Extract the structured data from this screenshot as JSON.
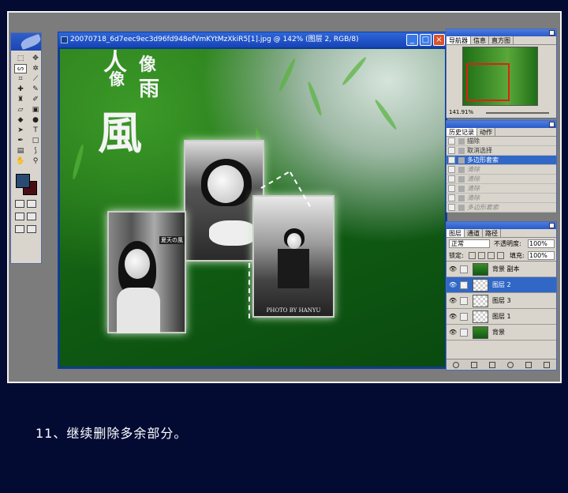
{
  "doc": {
    "title": "20070718_6d7eec9ec3d96fd948efVmKYtMzXkiR5[1].jpg @ 142% (图层 2, RGB/8)",
    "btn_min": "_",
    "btn_max": "□",
    "btn_close": "×"
  },
  "canvas": {
    "calligraphy": [
      "人",
      "像",
      "風",
      "雨",
      "像"
    ],
    "photo2_badge": "夏天の風",
    "photo3_credit": "PHOTO BY HANYU"
  },
  "navigator": {
    "tabs": [
      "导航器",
      "信息",
      "直方图"
    ],
    "zoom": "141.91%"
  },
  "history": {
    "tabs": [
      "历史记录",
      "动作"
    ],
    "rows": [
      {
        "label": "描除",
        "state": "normal"
      },
      {
        "label": "取消选择",
        "state": "normal"
      },
      {
        "label": "多边形套索",
        "state": "selected"
      },
      {
        "label": "清除",
        "state": "dim"
      },
      {
        "label": "清除",
        "state": "dim"
      },
      {
        "label": "清除",
        "state": "dim"
      },
      {
        "label": "清除",
        "state": "dim"
      },
      {
        "label": "多边形套索",
        "state": "dim"
      }
    ]
  },
  "layers": {
    "tabs": [
      "图层",
      "通道",
      "路径"
    ],
    "blend_mode": "正常",
    "opacity_label": "不透明度:",
    "opacity": "100%",
    "lock_label": "锁定:",
    "fill_label": "填充:",
    "fill": "100%",
    "rows": [
      {
        "name": "背景 副本",
        "selected": false
      },
      {
        "name": "图层 2",
        "selected": true
      },
      {
        "name": "图层 3",
        "selected": false
      },
      {
        "name": "图层 1",
        "selected": false
      },
      {
        "name": "背景",
        "selected": false
      }
    ]
  },
  "caption": "11、继续删除多余部分。",
  "colors": {
    "foreground": "#2b4a73",
    "background": "#4a0d14",
    "accent": "#3168c6"
  }
}
